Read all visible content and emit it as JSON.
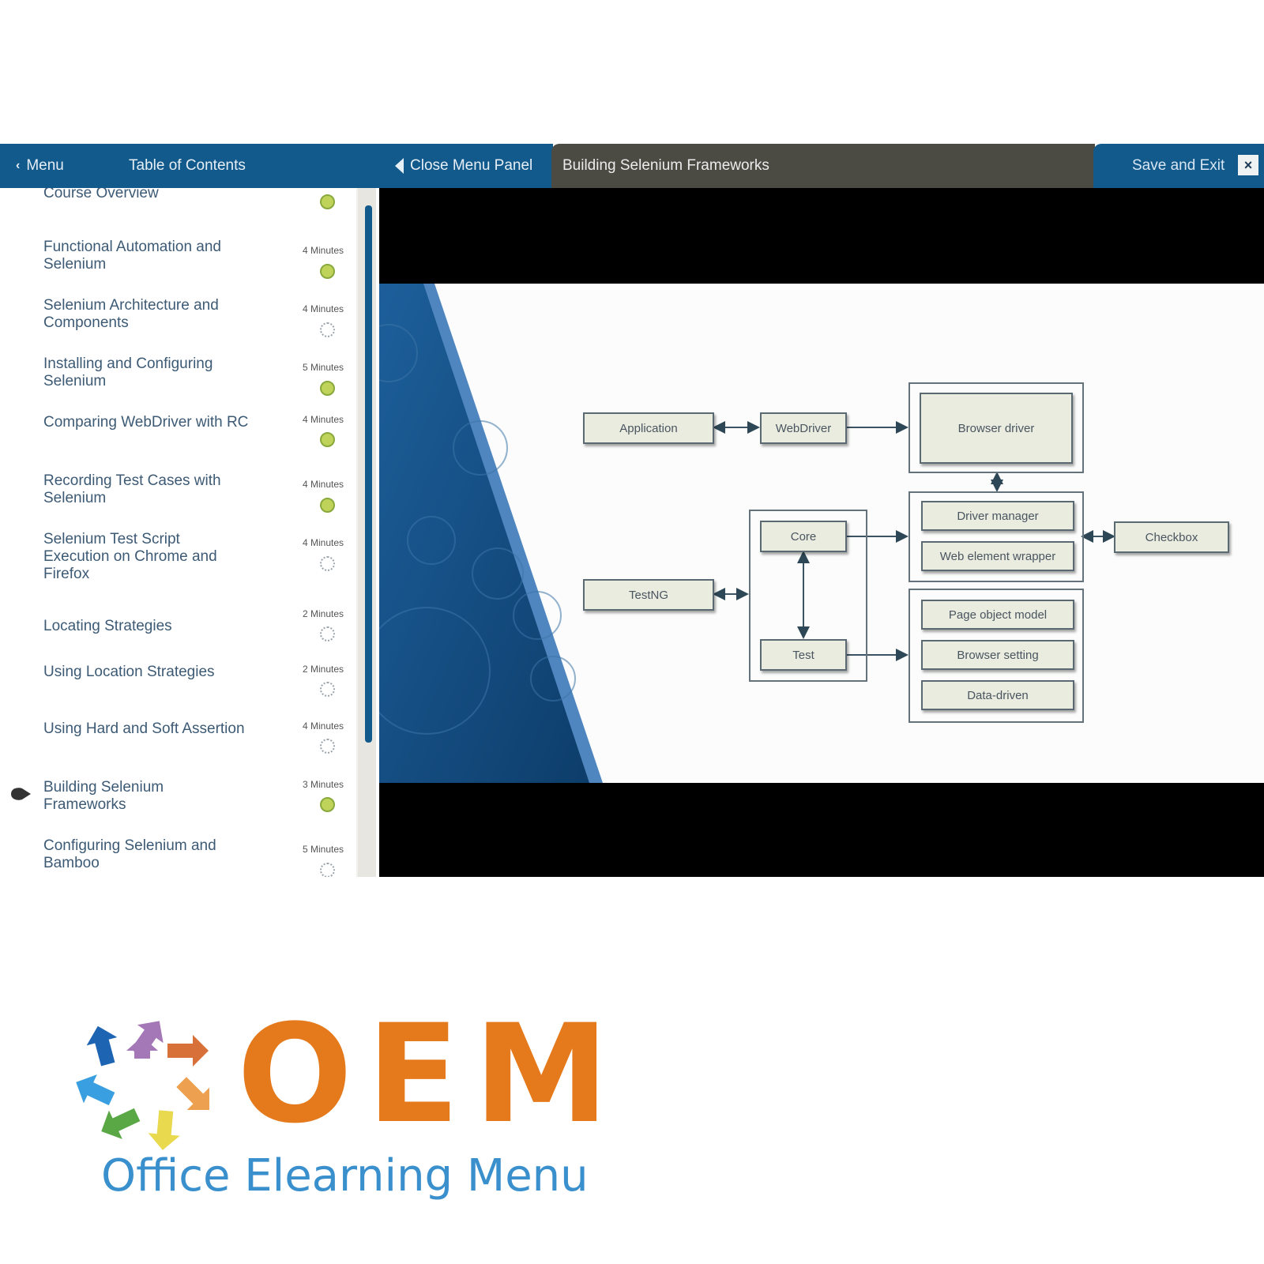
{
  "topbar": {
    "menu_label": "Menu",
    "toc_title": "Table of Contents",
    "close_panel_label": "Close Menu Panel",
    "lesson_title": "Building Selenium Frameworks",
    "save_exit_label": "Save and Exit",
    "close_icon": "×"
  },
  "toc": {
    "items": [
      {
        "label": "Course Overview",
        "duration": "",
        "status": "complete",
        "current": false
      },
      {
        "label": "Functional Automation and Selenium",
        "duration": "4 Minutes",
        "status": "complete",
        "current": false
      },
      {
        "label": "Selenium Architecture and Components",
        "duration": "4 Minutes",
        "status": "incomplete",
        "current": false
      },
      {
        "label": "Installing and Configuring Selenium",
        "duration": "5 Minutes",
        "status": "complete",
        "current": false
      },
      {
        "label": "Comparing WebDriver with RC",
        "duration": "4 Minutes",
        "status": "complete",
        "current": false
      },
      {
        "label": "Recording Test Cases with Selenium",
        "duration": "4 Minutes",
        "status": "complete",
        "current": false
      },
      {
        "label": "Selenium Test Script Execution on Chrome and Firefox",
        "duration": "4 Minutes",
        "status": "incomplete",
        "current": false
      },
      {
        "label": "Locating Strategies",
        "duration": "2 Minutes",
        "status": "incomplete",
        "current": false
      },
      {
        "label": "Using Location Strategies",
        "duration": "2 Minutes",
        "status": "incomplete",
        "current": false
      },
      {
        "label": "Using Hard and Soft Assertion",
        "duration": "4 Minutes",
        "status": "incomplete",
        "current": false
      },
      {
        "label": "Building Selenium Frameworks",
        "duration": "3 Minutes",
        "status": "complete",
        "current": true
      },
      {
        "label": "Configuring Selenium and Bamboo",
        "duration": "5 Minutes",
        "status": "incomplete",
        "current": false
      }
    ]
  },
  "diagram": {
    "nodes": {
      "application": "Application",
      "webdriver": "WebDriver",
      "browser_driver": "Browser driver",
      "driver_manager": "Driver manager",
      "web_element_wrapper": "Web element wrapper",
      "checkbox": "Checkbox",
      "testng": "TestNG",
      "core": "Core",
      "test": "Test",
      "page_object_model": "Page object model",
      "browser_setting": "Browser setting",
      "data_driven": "Data-driven"
    }
  },
  "logo": {
    "brand": "OEM",
    "tagline": "Office Elearning Menu",
    "colors": {
      "brand_orange": "#e57a1c",
      "tagline_blue": "#3a8fcd"
    }
  },
  "colors": {
    "nav_blue": "#135a8c",
    "title_bar": "#4b4a43",
    "status_complete": "#bfd35a"
  }
}
